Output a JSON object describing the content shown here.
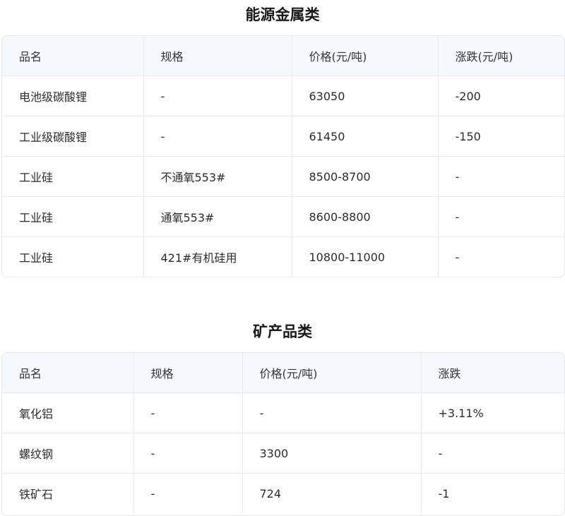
{
  "sections": [
    {
      "title": "能源金属类",
      "headers": [
        "品名",
        "规格",
        "价格(元/吨)",
        "涨跌(元/吨)"
      ],
      "rows": [
        [
          "电池级碳酸锂",
          "-",
          "63050",
          "-200"
        ],
        [
          "工业级碳酸锂",
          "-",
          "61450",
          "-150"
        ],
        [
          "工业硅",
          "不通氧553#",
          "8500-8700",
          "-"
        ],
        [
          "工业硅",
          "通氧553#",
          "8600-8800",
          "-"
        ],
        [
          "工业硅",
          "421#有机硅用",
          "10800-11000",
          "-"
        ]
      ]
    },
    {
      "title": "矿产品类",
      "headers": [
        "品名",
        "规格",
        "价格(元/吨)",
        "涨跌"
      ],
      "rows": [
        [
          "氧化铝",
          "-",
          "-",
          "+3.11%"
        ],
        [
          "螺纹钢",
          "-",
          "3300",
          "-"
        ],
        [
          "铁矿石",
          "-",
          "724",
          "-1"
        ]
      ]
    }
  ]
}
